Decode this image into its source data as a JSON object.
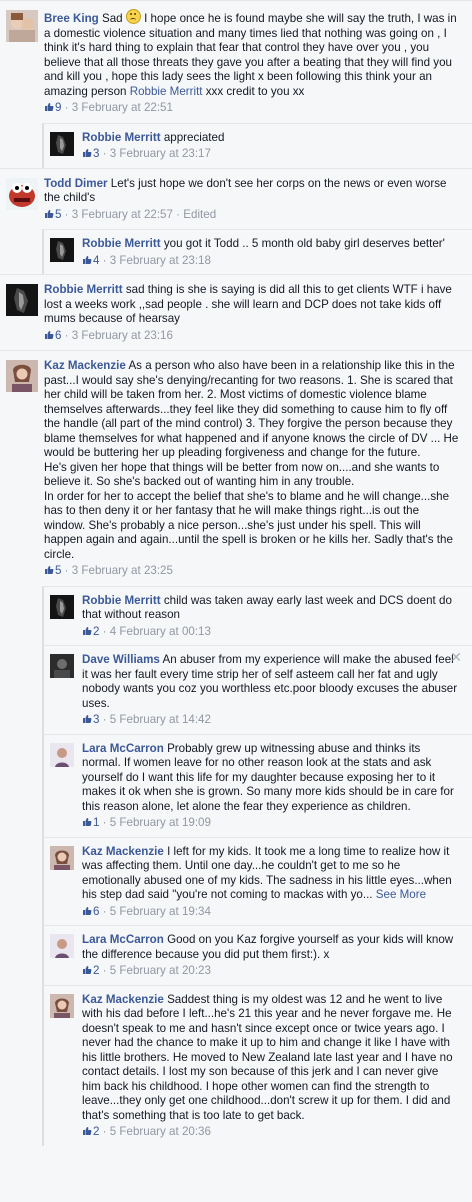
{
  "comments": [
    {
      "name": "Bree King",
      "text_before": "Sad",
      "text_after": "I hope once he is found maybe she will say the truth, I was in a domestic violence situation and many times lied that nothing was going on , I think it's hard thing to explain that fear that control they have over you , you believe that all those threats they gave you after a beating that they will find you and kill you , hope this lady sees the light x been following this think your an amazing person ",
      "mention": "Robbie Merritt",
      "text_end": " xxx credit to you xx",
      "likes": "9",
      "time": "3 February at 22:51",
      "replies": [
        {
          "name": "Robbie Merritt",
          "text": "appreciated",
          "likes": "3",
          "time": "3 February at 23:17"
        }
      ]
    },
    {
      "name": "Todd Dimer",
      "text": "Let's just hope we don't see her corps on the news or even worse the child's",
      "likes": "5",
      "time": "3 February at 22:57",
      "edited": "Edited",
      "replies": [
        {
          "name": "Robbie Merritt",
          "text": "you got it Todd .. 5 month old baby girl deserves better'",
          "likes": "4",
          "time": "3 February at 23:18"
        }
      ]
    },
    {
      "name": "Robbie Merritt",
      "text": "sad thing is she is saying is did all this to get clients WTF i have lost a weeks work ,,sad people . she will learn and DCP does not take kids off mums because of hearsay",
      "likes": "6",
      "time": "3 February at 23:16"
    },
    {
      "name": "Kaz Mackenzie",
      "text": "As a person who also have been in a relationship like this in the past...I would say she's denying/recanting for two reasons. 1. She is scared that her child will be taken from her. 2. Most victims of domestic violence blame themselves afterwards...they feel like they did something to cause him to fly off the handle (all part of the mind control) 3. They forgive the person because they blame themselves for what happened and if anyone knows the circle of DV ... He would be buttering her up pleading forgiveness and change for the future.",
      "text2": "He's given her hope that things will be better from now on....and she wants to believe it. So she's backed out of wanting him in any trouble.",
      "text3": "In order for her to accept the belief that she's to blame and he will change...she has to then deny it or her fantasy that he will make things right...is out the window. She's probably a nice person...she's just under his spell. This will happen again and again...until the spell is broken or he kills her. Sadly that's the circle.",
      "likes": "5",
      "time": "3 February at 23:25",
      "replies": [
        {
          "name": "Robbie Merritt",
          "text": "child was taken away early last week and DCS doent do that without reason",
          "likes": "2",
          "time": "4 February at 00:13"
        },
        {
          "name": "Dave Williams",
          "text": "An abuser from my experience will make the abused feel it was her fault every time strip her of self asteem call her fat and ugly nobody wants you coz you worthless etc.poor bloody excuses the abuser uses.",
          "likes": "3",
          "time": "5 February at 14:42",
          "close": "✕"
        },
        {
          "name": "Lara McCarron",
          "text": "Probably grew up witnessing abuse and thinks its normal. If women leave for no other reason look at the stats and ask yourself do I want this life for my daughter because exposing her to it makes it ok when she is grown. So many more kids should be in care for this reason alone, let alone the fear they experience as children.",
          "likes": "1",
          "time": "5 February at 19:09"
        },
        {
          "name": "Kaz Mackenzie",
          "text": "I left for my kids. It took me a long time to realize how it was affecting them. Until one day...he couldn't get to me so he emotionally abused one of my kids. The sadness in his little eyes...when his step dad said \"you're not coming to mackas with yo...",
          "see_more": "See More",
          "likes": "6",
          "time": "5 February at 19:34"
        },
        {
          "name": "Lara McCarron",
          "text": "Good on you Kaz forgive yourself as your kids will know the difference because you did put them first:). x",
          "likes": "2",
          "time": "5 February at 20:23"
        },
        {
          "name": "Kaz Mackenzie",
          "text": "Saddest thing is my oldest was 12 and he went to live with his dad before I left...he's 21 this year and he never forgave me. He doesn't speak to me and hasn't since except once or twice years ago. I never had the chance to make it up to him and change it like I have with his little brothers. He moved to New Zealand late last year and I have no contact details. I lost my son because of this jerk and I can never give him back his childhood. I hope other women can find the strength to leave...they only get one childhood...don't screw it up for them. I did and that's something that is too late to get back.",
          "likes": "2",
          "time": "5 February at 20:36"
        }
      ]
    }
  ],
  "separator": " · ",
  "colors": {
    "link": "#3b5998",
    "meta": "#9197a3",
    "bg": "#f6f7f9"
  }
}
